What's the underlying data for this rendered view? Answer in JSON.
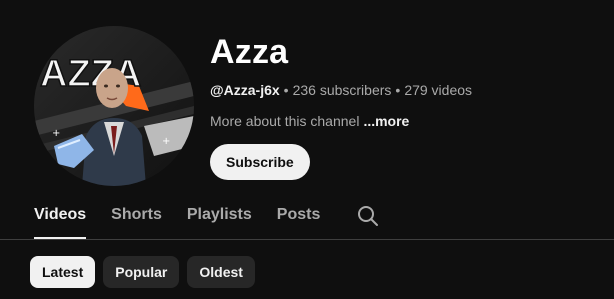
{
  "channel": {
    "name": "Azza",
    "handle": "@Azza-j6x",
    "subscribers": "236 subscribers",
    "videos": "279 videos",
    "separator": "•",
    "about_text": "More about this channel",
    "about_more": "...more",
    "subscribe_label": "Subscribe",
    "avatar_text": "AZZA"
  },
  "tabs": [
    {
      "label": "Videos",
      "active": true
    },
    {
      "label": "Shorts",
      "active": false
    },
    {
      "label": "Playlists",
      "active": false
    },
    {
      "label": "Posts",
      "active": false
    }
  ],
  "search_icon": "search-icon",
  "chips": [
    {
      "label": "Latest",
      "active": true
    },
    {
      "label": "Popular",
      "active": false
    },
    {
      "label": "Oldest",
      "active": false
    }
  ],
  "colors": {
    "background": "#0f0f0f",
    "text_primary": "#f1f1f1",
    "text_secondary": "#aaaaaa",
    "chip_bg": "#272727",
    "accent_orange": "#ff6a1a"
  }
}
